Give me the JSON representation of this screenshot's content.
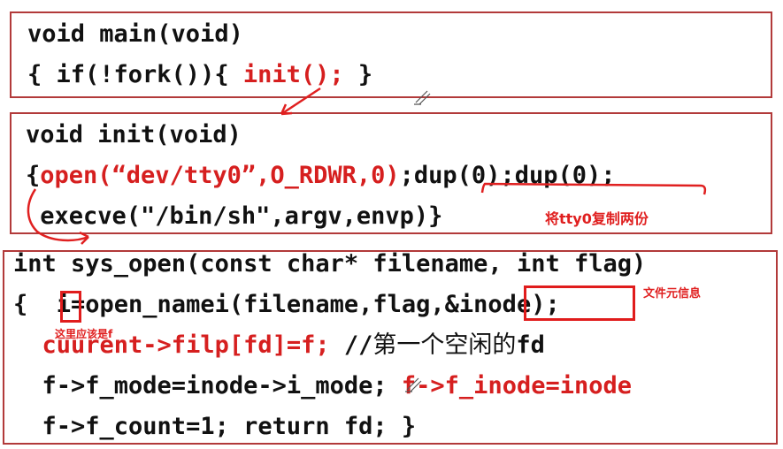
{
  "box1": {
    "line1": "void main(void)",
    "line2_a": "{ if(!fork()){ ",
    "line2_b": "init();",
    "line2_c": " }"
  },
  "box2": {
    "line1": "void init(void)",
    "line2_a": "{",
    "line2_b": "open(“dev/tty0”,O_RDWR,0)",
    "line2_c": ";dup(0);dup(0);",
    "line3": " execve(\"/bin/sh\",argv,envp)}",
    "annotation": "将tty0复制两份"
  },
  "box3": {
    "line1": "int sys_open(const char* filename, int flag)",
    "line2": "{  i=open_namei(filename,flag,&inode);",
    "line3_a": "  cuurent->filp[fd]=f;",
    "line3_b": " //",
    "line3_cn": "第一个空闲的",
    "line3_fd": "fd",
    "line4_a": "  f->f_mode=inode->i_mode; ",
    "line4_b": "f->f_inode=inode",
    "line5": "  f->f_count=1; return fd; }",
    "note_i": "这里应该是f",
    "note_inode": "文件元信息"
  },
  "colors": {
    "accent": "#d61f1f",
    "border": "#b23a3a"
  }
}
